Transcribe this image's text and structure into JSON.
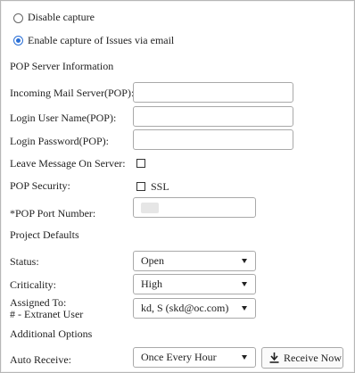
{
  "capture": {
    "disable_label": "Disable capture",
    "enable_label": "Enable capture of Issues via email"
  },
  "pop_server": {
    "section_title": "POP Server Information",
    "incoming_label": "Incoming Mail Server(POP):",
    "incoming_value": "",
    "login_user_label": "Login User Name(POP):",
    "login_user_value": "",
    "login_password_label": "Login Password(POP):",
    "login_password_value": "",
    "leave_message_label": "Leave Message On Server:",
    "pop_security_label": "POP Security:",
    "ssl_label": "SSL",
    "port_label": "*POP Port Number:"
  },
  "project_defaults": {
    "section_title": "Project Defaults",
    "status_label": "Status:",
    "status_value": "Open",
    "criticality_label": "Criticality:",
    "criticality_value": "High",
    "assigned_label": "Assigned To:",
    "assigned_sub_label": "# - Extranet User",
    "assigned_value": "kd, S (skd@oc.com)"
  },
  "additional_options": {
    "section_title": "Additional Options",
    "auto_receive_label": "Auto Receive:",
    "auto_receive_value": "Once Every Hour",
    "receive_now_label": "Receive Now"
  },
  "colors": {
    "radio_accent": "#2a6fd6",
    "border": "#a9a9a9"
  },
  "icons": {
    "receive_now": "download-icon"
  }
}
